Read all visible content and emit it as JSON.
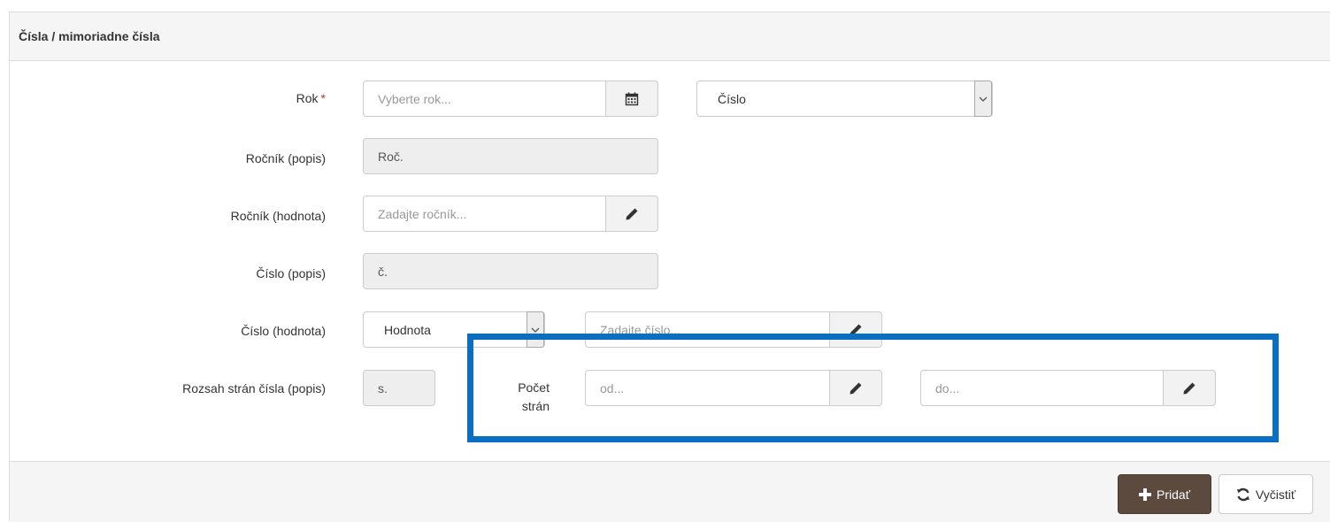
{
  "panel": {
    "title": "Čísla / mimoriadne čísla"
  },
  "form": {
    "rok": {
      "label": "Rok",
      "required_mark": "*",
      "placeholder": "Vyberte rok...",
      "addon_icon": "calendar-icon"
    },
    "type_select": {
      "selected": "Číslo"
    },
    "rocnik_popis": {
      "label": "Ročník (popis)",
      "value": "Roč."
    },
    "rocnik_hodnota": {
      "label": "Ročník (hodnota)",
      "placeholder": "Zadajte ročník...",
      "addon_icon": "pencil-icon"
    },
    "cislo_popis": {
      "label": "Číslo (popis)",
      "value": "č."
    },
    "cislo_hodnota": {
      "label": "Číslo (hodnota)",
      "select_selected": "Hodnota",
      "placeholder": "Zadajte číslo...",
      "addon_icon": "pencil-icon"
    },
    "rozsah": {
      "label": "Rozsah strán čísla (popis)",
      "value": "s.",
      "pocet_label_line1": "Počet",
      "pocet_label_line2": "strán",
      "from_placeholder": "od...",
      "to_placeholder": "do...",
      "addon_icon": "pencil-icon"
    }
  },
  "footer": {
    "add_label": "Pridať",
    "clear_label": "Vyčistiť"
  },
  "colors": {
    "highlight": "#0a6fc2",
    "add_button": "#5c4a3e",
    "required": "#c9302c"
  }
}
